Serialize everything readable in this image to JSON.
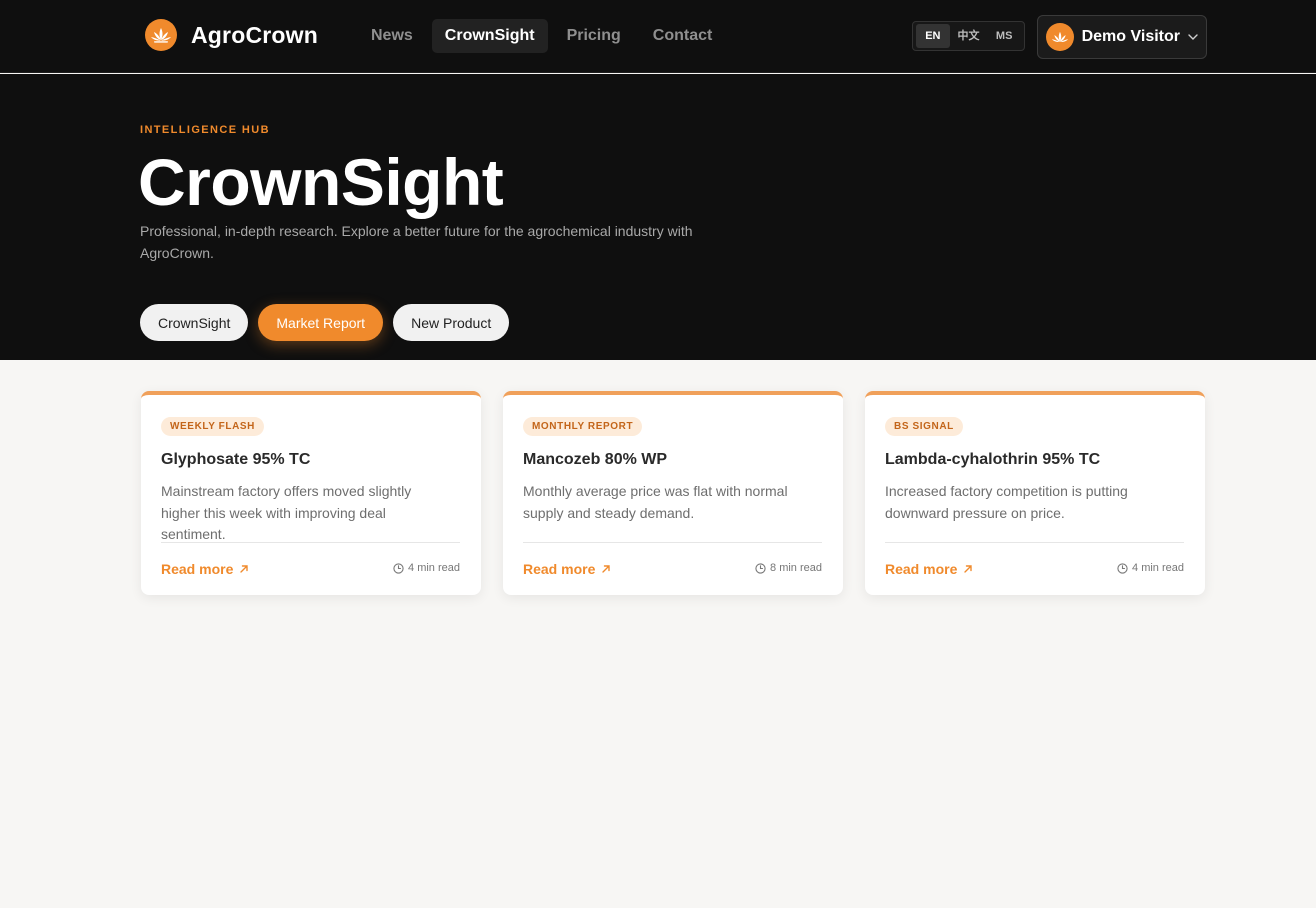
{
  "brand": {
    "name": "AgroCrown"
  },
  "nav": [
    {
      "label": "News",
      "active": false
    },
    {
      "label": "CrownSight",
      "active": true
    },
    {
      "label": "Pricing",
      "active": false
    },
    {
      "label": "Contact",
      "active": false
    }
  ],
  "languages": [
    {
      "label": "EN",
      "active": true
    },
    {
      "label": "中文",
      "active": false
    },
    {
      "label": "MS",
      "active": false
    }
  ],
  "user": {
    "name": "Demo Visitor"
  },
  "hero": {
    "eyebrow": "INTELLIGENCE HUB",
    "title": "CrownSight",
    "subtitle": "Professional, in-depth research. Explore a better future for the agrochemical industry with AgroCrown."
  },
  "filters": [
    {
      "label": "CrownSight",
      "active": false
    },
    {
      "label": "Market Report",
      "active": true
    },
    {
      "label": "New Product",
      "active": false
    }
  ],
  "cards": [
    {
      "tag": "WEEKLY FLASH",
      "title": "Glyphosate 95% TC",
      "description": "Mainstream factory offers moved slightly higher this week with improving deal sentiment.",
      "link": "Read more",
      "read_time": "4 min read"
    },
    {
      "tag": "MONTHLY REPORT",
      "title": "Mancozeb 80% WP",
      "description": "Monthly average price was flat with normal supply and steady demand.",
      "link": "Read more",
      "read_time": "8 min read"
    },
    {
      "tag": "BS SIGNAL",
      "title": "Lambda-cyhalothrin 95% TC",
      "description": "Increased factory competition is putting downward pressure on price.",
      "link": "Read more",
      "read_time": "4 min read"
    }
  ],
  "colors": {
    "accent": "#f08a2c",
    "dark_bg": "#0f0f0f",
    "page_bg": "#f7f6f4"
  }
}
